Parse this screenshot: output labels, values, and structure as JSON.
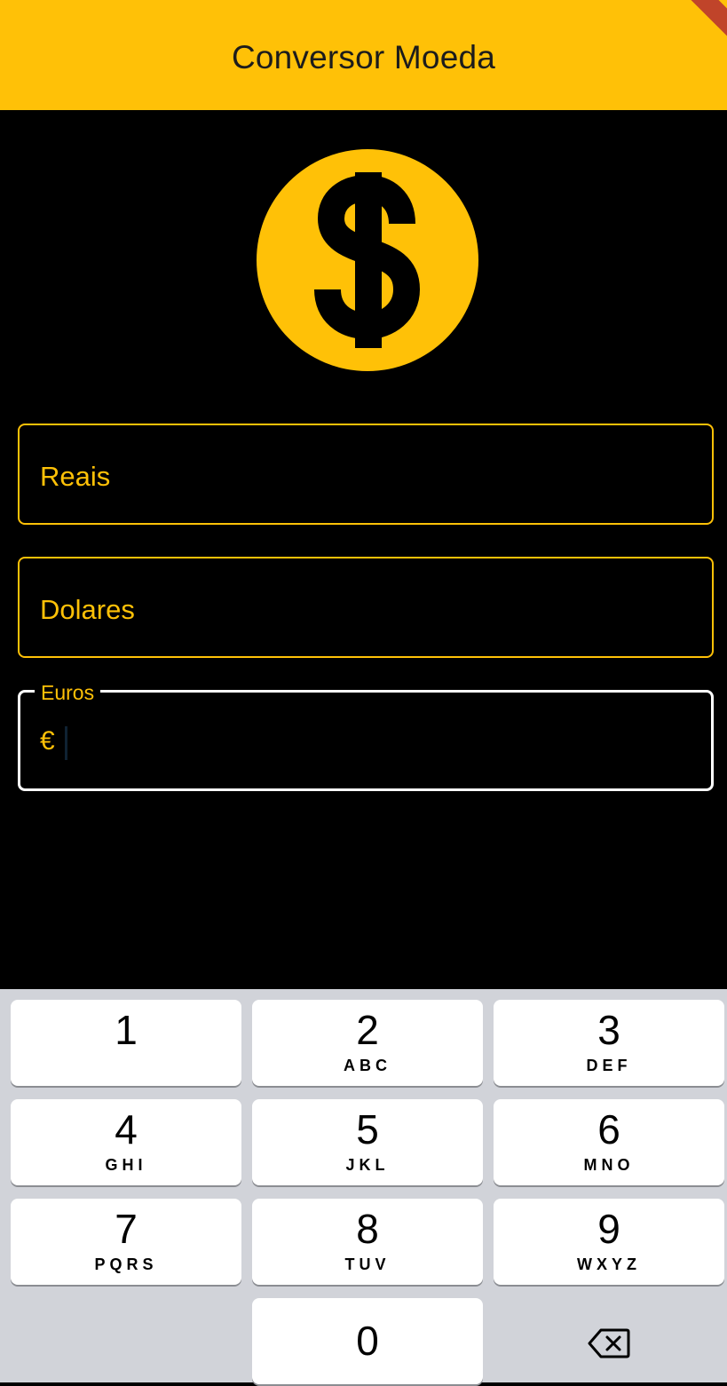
{
  "appbar": {
    "title": "Conversor Moeda",
    "color": "#FFC107"
  },
  "icon": {
    "name": "dollar-coin-icon"
  },
  "fields": {
    "reais": {
      "label": "Reais"
    },
    "dolares": {
      "label": "Dolares"
    },
    "euros": {
      "label": "Euros",
      "prefix": "€",
      "value": ""
    }
  },
  "keyboard": {
    "keys": [
      {
        "digit": "1",
        "letters": ""
      },
      {
        "digit": "2",
        "letters": "ABC"
      },
      {
        "digit": "3",
        "letters": "DEF"
      },
      {
        "digit": "4",
        "letters": "GHI"
      },
      {
        "digit": "5",
        "letters": "JKL"
      },
      {
        "digit": "6",
        "letters": "MNO"
      },
      {
        "digit": "7",
        "letters": "PQRS"
      },
      {
        "digit": "8",
        "letters": "TUV"
      },
      {
        "digit": "9",
        "letters": "WXYZ"
      },
      {
        "digit": "0",
        "letters": ""
      }
    ],
    "backspace_icon": "backspace-icon"
  }
}
